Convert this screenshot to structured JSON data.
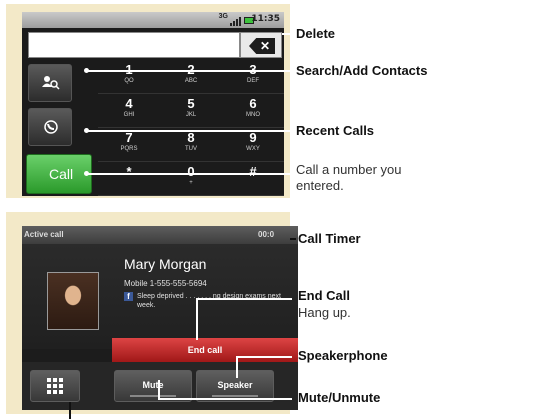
{
  "dialer": {
    "status_network": "3G",
    "status_time": "11:35",
    "delete_glyph": "✕",
    "keys": [
      {
        "num": "1",
        "letters": "QO"
      },
      {
        "num": "2",
        "letters": "ABC"
      },
      {
        "num": "3",
        "letters": "DEF"
      },
      {
        "num": "4",
        "letters": "GHI"
      },
      {
        "num": "5",
        "letters": "JKL"
      },
      {
        "num": "6",
        "letters": "MNO"
      },
      {
        "num": "7",
        "letters": "PQRS"
      },
      {
        "num": "8",
        "letters": "TUV"
      },
      {
        "num": "9",
        "letters": "WXY"
      },
      {
        "num": "*",
        "letters": ""
      },
      {
        "num": "0",
        "letters": "+"
      },
      {
        "num": "#",
        "letters": ""
      }
    ],
    "call_label": "Call",
    "icons": {
      "contacts": "contacts-search-icon",
      "recent": "recent-calls-icon",
      "delete": "backspace-icon"
    }
  },
  "active_call": {
    "header": "Active call",
    "timer": "00:0",
    "name": "Mary Morgan",
    "number": "Mobile 1-555-555-5694",
    "status_icon": "f",
    "status_text": "Sleep deprived . . . . . . . ng design exams next week.",
    "end_call_label": "End call",
    "mute_label": "Mute",
    "speaker_label": "Speaker",
    "icons": {
      "dialpad": "dialpad-icon",
      "social": "facebook-icon"
    }
  },
  "callouts": {
    "delete": "Delete",
    "search_add_contacts": "Search/Add Contacts",
    "recent_calls": "Recent Calls",
    "call_desc_line1": "Call a number you",
    "call_desc_line2": "entered.",
    "call_timer": "Call Timer",
    "end_call": "End Call",
    "end_call_desc": "Hang up.",
    "speakerphone": "Speakerphone",
    "mute_unmute": "Mute/Unmute"
  },
  "colors": {
    "call_green": "#3cae3c",
    "end_red": "#c62828",
    "frame_bg": "#f3e9c8"
  }
}
